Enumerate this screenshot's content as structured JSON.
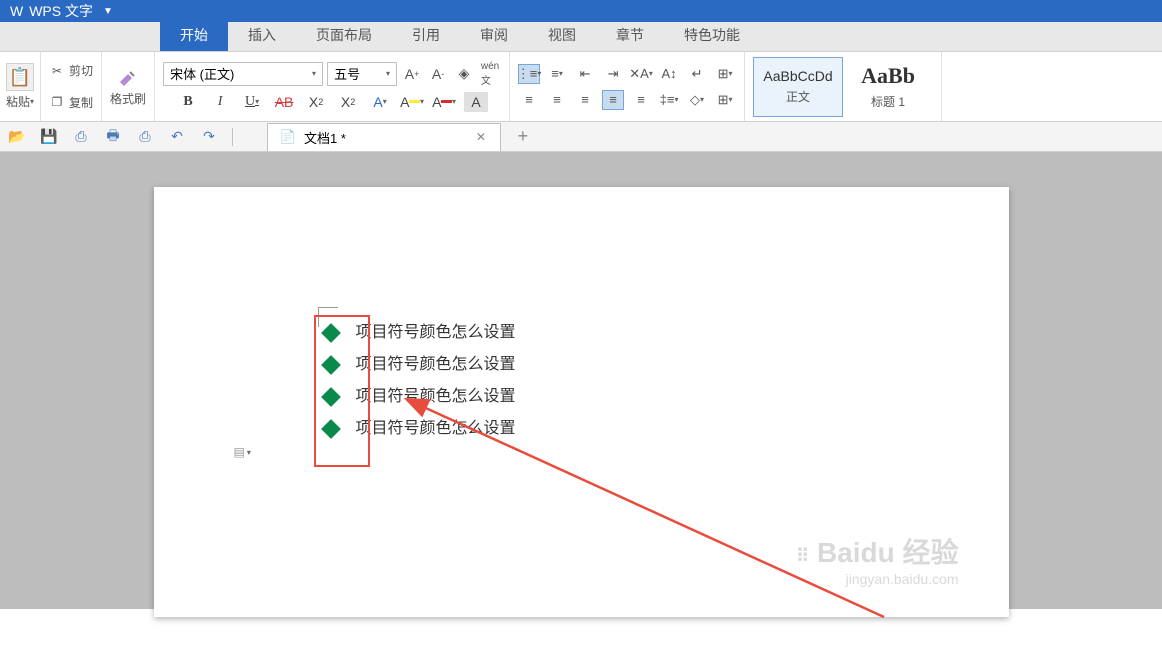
{
  "app": {
    "title": "WPS 文字"
  },
  "tabs": {
    "items": [
      "开始",
      "插入",
      "页面布局",
      "引用",
      "审阅",
      "视图",
      "章节",
      "特色功能"
    ],
    "active_index": 0
  },
  "ribbon": {
    "paste_label": "粘贴",
    "cut_label": "剪切",
    "copy_label": "复制",
    "format_painter_label": "格式刷",
    "font_name": "宋体 (正文)",
    "font_size": "五号",
    "bold": "B",
    "italic": "I",
    "underline": "U",
    "strike": "A",
    "super": "X",
    "sub": "X",
    "font_color_a": "A",
    "highlight_a": "A",
    "text_a": "A",
    "shade_a": "A"
  },
  "styles": {
    "items": [
      {
        "preview": "AaBbCcDd",
        "label": "正文"
      },
      {
        "preview": "AaBb",
        "label": "标题 1"
      }
    ]
  },
  "doc_tabs": {
    "items": [
      "文档1 *"
    ]
  },
  "document": {
    "bullet_items": [
      "项目符号颜色怎么设置",
      "项目符号颜色怎么设置",
      "项目符号颜色怎么设置",
      "项目符号颜色怎么设置"
    ]
  },
  "watermark": {
    "main": "Baidu 经验",
    "sub": "jingyan.baidu.com"
  }
}
